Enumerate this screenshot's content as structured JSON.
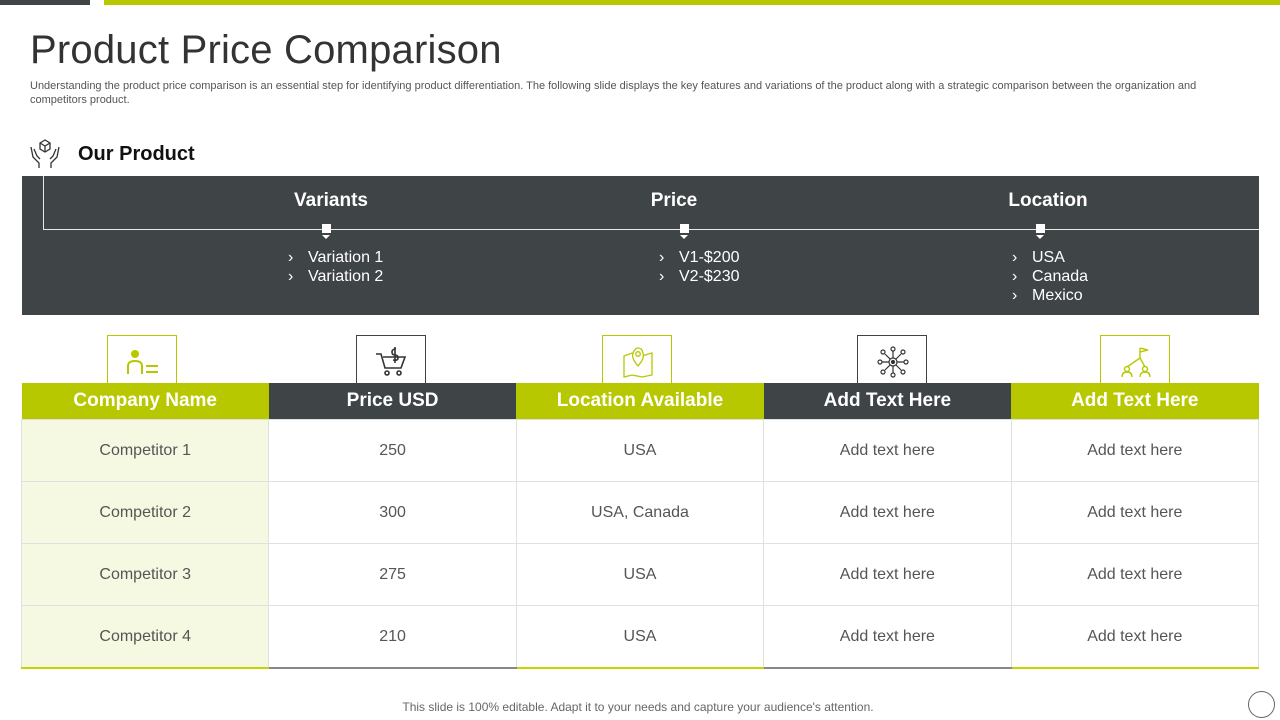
{
  "slide": {
    "title": "Product Price Comparison",
    "subtitle": "Understanding the product price comparison is an essential step for identifying product differentiation. The following slide displays the key features and variations of the product along with a strategic comparison between the organization and competitors product."
  },
  "section": {
    "icon": "box-in-hands-icon",
    "title": "Our Product"
  },
  "product": {
    "columns": [
      {
        "heading": "Variants",
        "items": [
          "Variation 1",
          "Variation 2"
        ]
      },
      {
        "heading": "Price",
        "items": [
          "V1-$200",
          "V2-$230"
        ]
      },
      {
        "heading": "Location",
        "items": [
          "USA",
          "Canada",
          "Mexico"
        ]
      }
    ],
    "bullet": "›"
  },
  "table": {
    "column_icons": [
      "user-list-icon",
      "shopping-cart-dollar-icon",
      "map-pin-icon",
      "network-gear-icon",
      "team-flag-icon"
    ],
    "headers": [
      "Company Name",
      "Price USD",
      "Location Available",
      "Add Text Here",
      "Add Text Here"
    ],
    "rows": [
      [
        "Competitor 1",
        "250",
        "USA",
        "Add text here",
        "Add text here"
      ],
      [
        "Competitor 2",
        "300",
        "USA, Canada",
        "Add text here",
        "Add text here"
      ],
      [
        "Competitor 3",
        "275",
        "USA",
        "Add text here",
        "Add text here"
      ],
      [
        "Competitor 4",
        "210",
        "USA",
        "Add text here",
        "Add text here"
      ]
    ]
  },
  "footer": "This slide is 100% editable. Adapt it to your needs and capture your audience's attention.",
  "colors": {
    "accent": "#b8c800",
    "dark": "#3f4447",
    "first_column_tint": "#f6f9e1"
  }
}
